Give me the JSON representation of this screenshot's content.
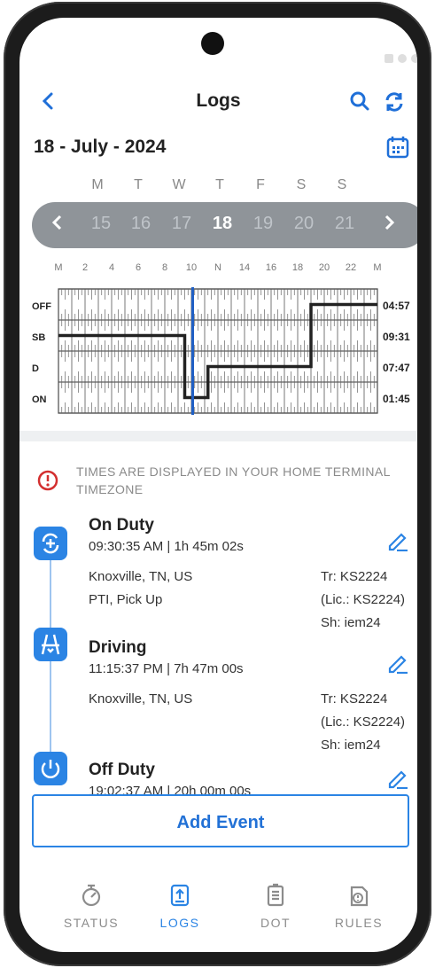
{
  "header": {
    "title": "Logs",
    "back_icon": "chevron-left-icon",
    "search_icon": "search-icon",
    "sync_icon": "sync-icon"
  },
  "date_label": "18 - July - 2024",
  "weekdays": [
    "M",
    "T",
    "W",
    "T",
    "F",
    "S",
    "S"
  ],
  "days": [
    "15",
    "16",
    "17",
    "18",
    "19",
    "20",
    "21"
  ],
  "selected_day": "18",
  "graph": {
    "hour_labels": [
      "M",
      "2",
      "4",
      "6",
      "8",
      "10",
      "N",
      "14",
      "16",
      "18",
      "20",
      "22",
      "M"
    ],
    "rows": [
      "OFF",
      "SB",
      "D",
      "ON"
    ],
    "totals": [
      "04:57",
      "09:31",
      "07:47",
      "01:45"
    ],
    "current_hour": 10.1,
    "segments": [
      {
        "status": "SB",
        "start": 0,
        "end": 9.5
      },
      {
        "status": "ON",
        "start": 9.5,
        "end": 11.25
      },
      {
        "status": "D",
        "start": 11.25,
        "end": 19.0
      },
      {
        "status": "OFF",
        "start": 19.0,
        "end": 24
      }
    ]
  },
  "notice": "TIMES ARE DISPLAYED IN YOUR HOME TERMINAL TIMEZONE",
  "events": [
    {
      "title": "On Duty",
      "subtitle": "09:30:35 AM | 1h 45m 02s",
      "location": "Knoxville, TN, US",
      "note": "PTI, Pick Up",
      "truck": "Tr: KS2224",
      "license": "(Lic.: KS2224)",
      "shipping": "Sh: iem24",
      "icon": "on-duty-icon"
    },
    {
      "title": "Driving",
      "subtitle": "11:15:37 PM | 7h 47m 00s",
      "location": "Knoxville, TN, US",
      "note": "",
      "truck": "Tr: KS2224",
      "license": "(Lic.: KS2224)",
      "shipping": "Sh: iem24",
      "icon": "driving-icon"
    },
    {
      "title": "Off Duty",
      "subtitle": "19:02:37 AM | 20h 00m 00s",
      "icon": "power-icon"
    }
  ],
  "add_event_label": "Add Event",
  "nav": [
    {
      "label": "STATUS",
      "icon": "status-icon",
      "active": false
    },
    {
      "label": "LOGS",
      "icon": "logs-icon",
      "active": true
    },
    {
      "label": "DOT",
      "icon": "dot-icon",
      "active": false
    },
    {
      "label": "RULES",
      "icon": "rules-icon",
      "active": false
    }
  ],
  "colors": {
    "accent": "#2b84e4",
    "pill": "#8f9499",
    "graph_line": "#222222",
    "now_line": "#1f5fc4",
    "alert": "#d32f2f"
  }
}
